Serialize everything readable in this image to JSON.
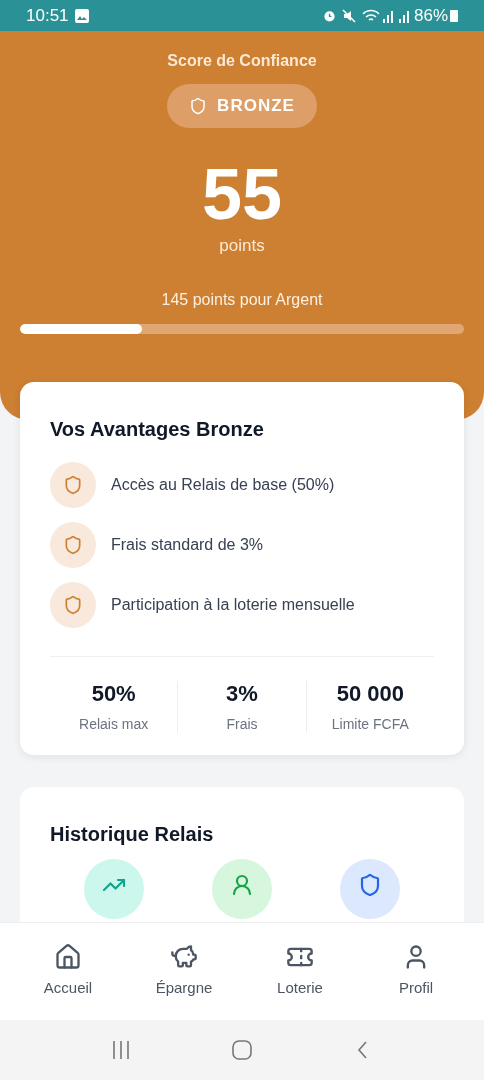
{
  "status_bar": {
    "time": "10:51",
    "battery": "86%"
  },
  "header": {
    "title": "Score de Confiance",
    "tier": "BRONZE",
    "score": "55",
    "unit": "points",
    "next_tier": "145 points pour Argent",
    "progress": {
      "level": 0.275
    }
  },
  "benefits_card": {
    "title": "Vos Avantages Bronze",
    "items": [
      "Accès au Relais de base (50%)",
      "Frais standard de 3%",
      "Participation à la loterie mensuelle"
    ],
    "stats": [
      {
        "value": "50%",
        "label": "Relais max"
      },
      {
        "value": "3%",
        "label": "Frais"
      },
      {
        "value": "50 000",
        "label": "Limite FCFA"
      }
    ]
  },
  "history_card": {
    "title": "Historique Relais",
    "icons": [
      {
        "kind": "trend",
        "color": "#ccf7ec"
      },
      {
        "kind": "user",
        "color": "#d6f6dd"
      },
      {
        "kind": "shield",
        "color": "#dce8fd"
      }
    ]
  },
  "bottom_nav": [
    {
      "kind": "home",
      "label": "Accueil",
      "selected": false
    },
    {
      "kind": "piggy",
      "label": "Épargne",
      "selected": false
    },
    {
      "kind": "ticket",
      "label": "Loterie",
      "selected": false
    },
    {
      "kind": "user",
      "label": "Profil",
      "selected": false
    }
  ]
}
